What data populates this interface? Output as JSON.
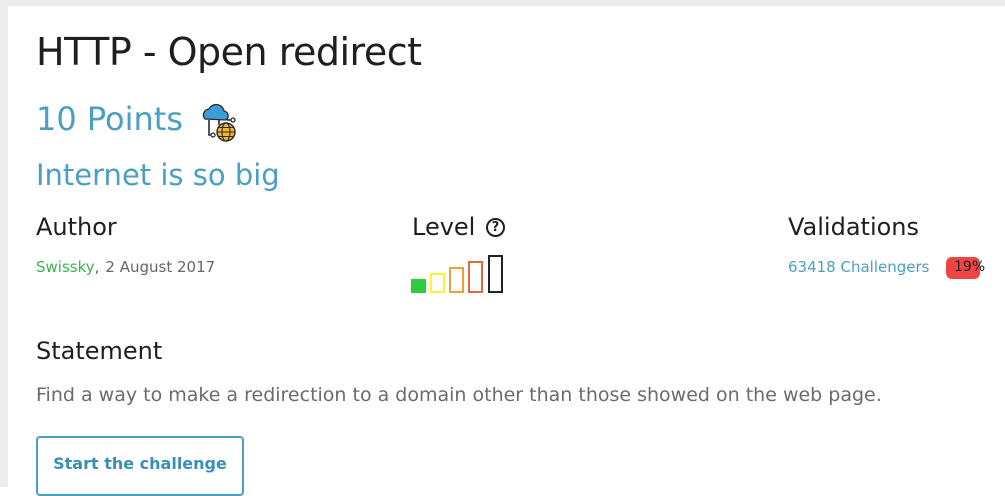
{
  "challenge": {
    "title": "HTTP - Open redirect",
    "points": "10 Points",
    "category_icon": "cloud-network-globe-icon",
    "subtitle": "Internet is so big"
  },
  "author": {
    "heading": "Author",
    "name": "Swissky",
    "separator": ",",
    "date": "2 August 2017"
  },
  "level": {
    "heading": "Level",
    "help_icon": "?",
    "value": 1,
    "max": 5,
    "colors": [
      "#2ecc40",
      "#f5f53b",
      "#e8a33b",
      "#e06a3b",
      "#222222"
    ]
  },
  "validations": {
    "heading": "Validations",
    "challengers": "63418 Challengers",
    "percentage": "19%",
    "badge_color": "#ef4444"
  },
  "statement": {
    "heading": "Statement",
    "text": "Find a way to make a redirection to a domain other than those showed on the web page."
  },
  "actions": {
    "start_label": "Start the challenge"
  },
  "colors": {
    "accent": "#4b9ec4",
    "author_link": "#3bb54a"
  }
}
